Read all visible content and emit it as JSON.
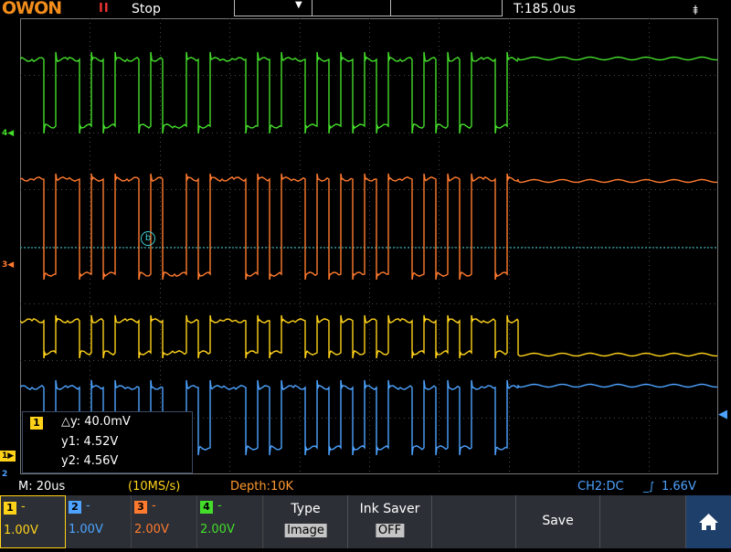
{
  "header": {
    "logo": "OWON",
    "run_state": "Stop",
    "trigger_time": "T:185.0us"
  },
  "channel_markers": {
    "ch4": "4",
    "ch3": "3",
    "ch1": "1",
    "ch2": "2",
    "cursor": "b"
  },
  "measure": {
    "channel": "1",
    "delta_y": "△y: 40.0mV",
    "y1": "y1: 4.52V",
    "y2": "y2: 4.56V"
  },
  "status": {
    "timebase": "M: 20us",
    "sample_rate": "(10MS/s)",
    "depth": "Depth:10K",
    "trigger": "CH2:DC",
    "trigger_level": "1.66V"
  },
  "channels": [
    {
      "num": "1",
      "dash": "-",
      "scale": "1.00V",
      "color": "#ffd21a"
    },
    {
      "num": "2",
      "dash": "-",
      "scale": "1.00V",
      "color": "#4da3ff"
    },
    {
      "num": "3",
      "dash": "-",
      "scale": "2.00V",
      "color": "#ff7a2e"
    },
    {
      "num": "4",
      "dash": "-",
      "scale": "2.00V",
      "color": "#44dd2a"
    }
  ],
  "menu": {
    "type_label": "Type",
    "type_value": "Image",
    "ink_label": "Ink Saver",
    "ink_value": "OFF",
    "save_label": "Save"
  },
  "colors": {
    "ch1": "#ffd21a",
    "ch2": "#4da3ff",
    "ch3": "#ff7a2e",
    "ch4": "#44dd2a",
    "grid": "#4a4a4a",
    "cursor": "#3fd0d8"
  }
}
